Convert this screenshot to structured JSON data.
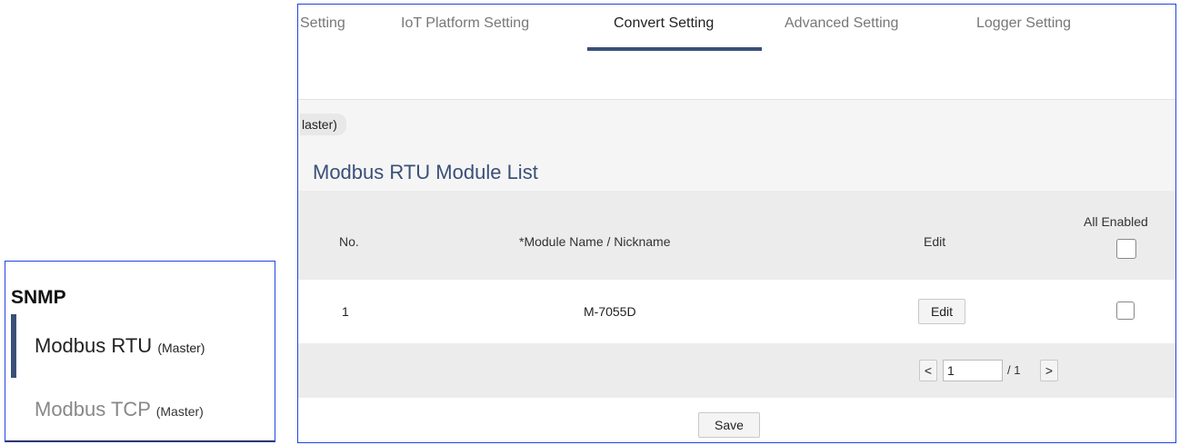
{
  "sidebar": {
    "title": "SNMP",
    "items": [
      {
        "label": "Modbus RTU",
        "sub": "(Master)"
      },
      {
        "label": "Modbus TCP",
        "sub": "(Master)"
      }
    ]
  },
  "tabs": [
    "Setting",
    "IoT Platform Setting",
    "Convert Setting",
    "Advanced Setting",
    "Logger Setting"
  ],
  "active_tab": "Convert Setting",
  "breadcrumb": "laster)",
  "module_list": {
    "title": "Modbus RTU Module List",
    "headers": {
      "no": "No.",
      "name": "*Module Name / Nickname",
      "edit": "Edit",
      "all_enabled": "All Enabled"
    },
    "rows": [
      {
        "no": "1",
        "name": "M-7055D",
        "edit_label": "Edit",
        "enabled": false
      }
    ]
  },
  "pager": {
    "prev": "<",
    "page": "1",
    "total": "/ 1",
    "next": ">"
  },
  "save_label": "Save",
  "colors": {
    "accent": "#3a5078",
    "frame": "#2244dd",
    "header_bg": "#ececec"
  }
}
